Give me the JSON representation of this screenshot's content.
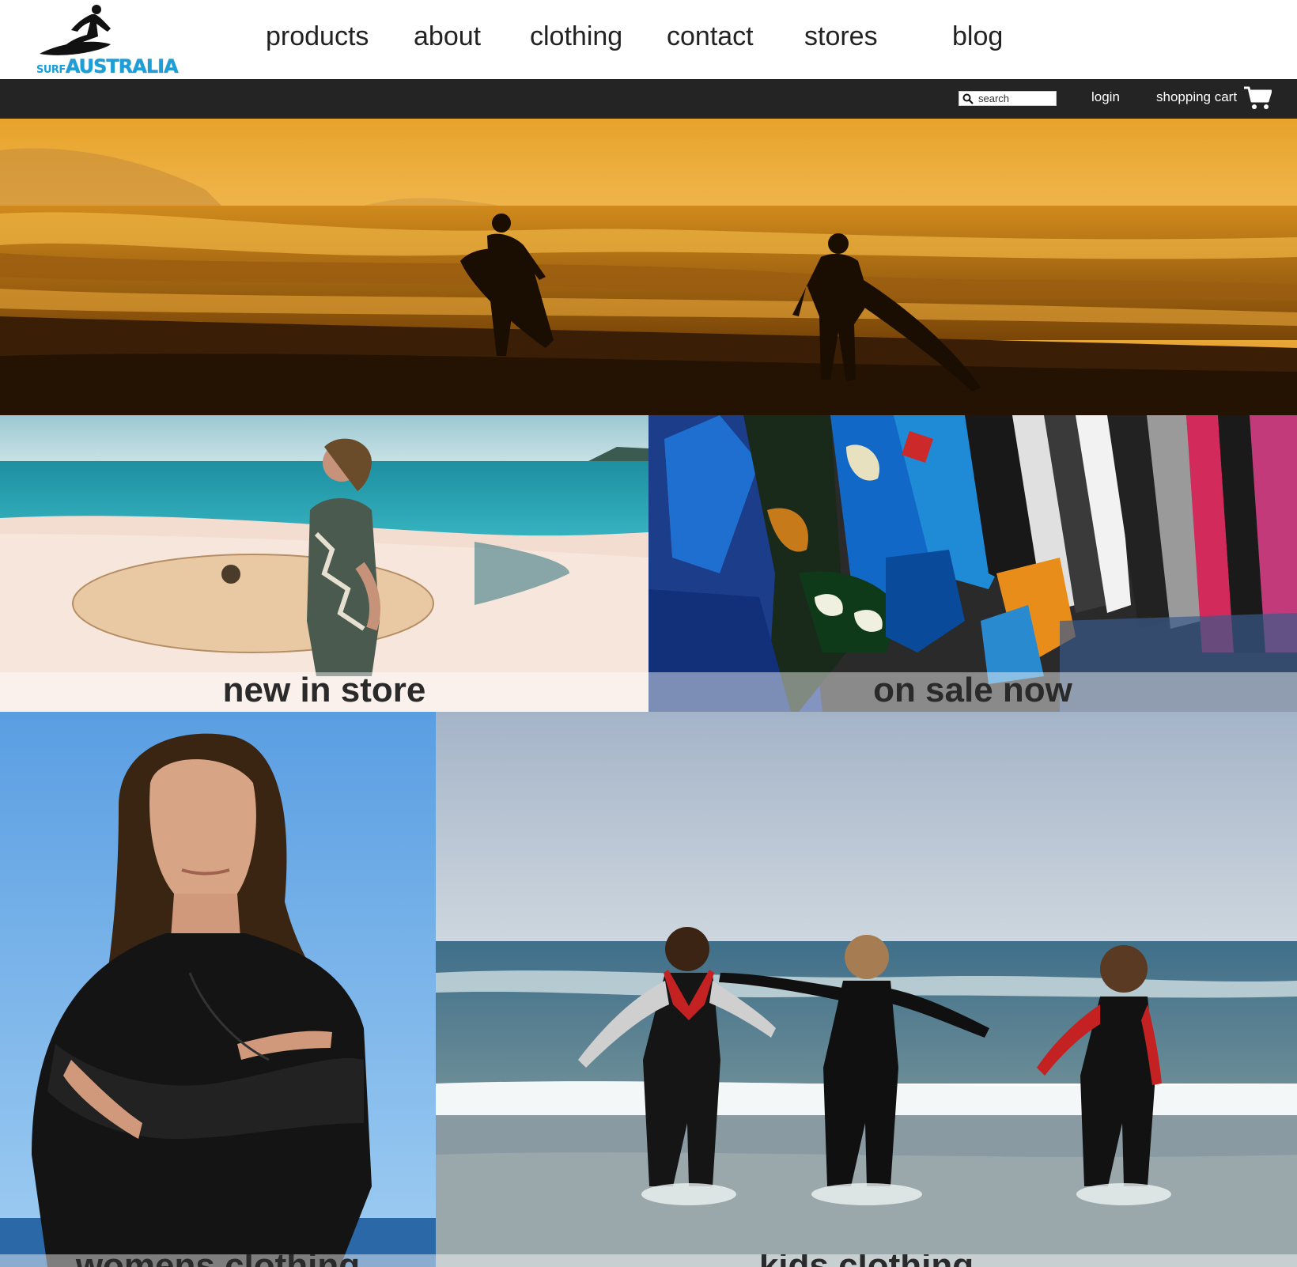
{
  "brand": {
    "logo_small": "SURF",
    "logo_large": "AUSTRALIA"
  },
  "nav": {
    "products": "products",
    "about": "about",
    "clothing": "clothing",
    "contact": "contact",
    "stores": "stores",
    "blog": "blog"
  },
  "utility": {
    "search_placeholder": "search",
    "login": "login",
    "cart": "shopping cart"
  },
  "tiles": {
    "new_in_store": "new in store",
    "on_sale_now": "on sale now",
    "womens_clothing": "womens clothing",
    "kids_clothing": "kids clothing"
  },
  "colors": {
    "bar": "#242424",
    "brand_blue": "#1a9fd8",
    "sunset_orange": "#e39a1c"
  }
}
